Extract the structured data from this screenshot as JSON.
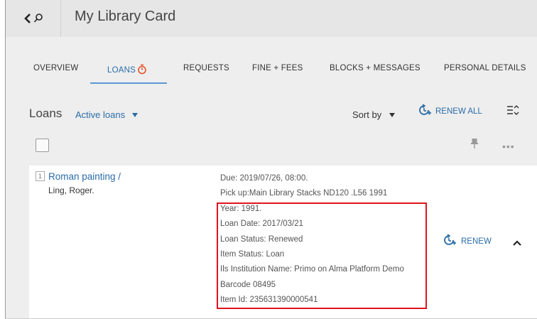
{
  "header": {
    "title": "My Library Card"
  },
  "tabs": [
    {
      "label": "OVERVIEW"
    },
    {
      "label": "LOANS"
    },
    {
      "label": "REQUESTS"
    },
    {
      "label": "FINE + FEES"
    },
    {
      "label": "BLOCKS + MESSAGES"
    },
    {
      "label": "PERSONAL DETAILS"
    }
  ],
  "active_tab": "LOANS",
  "loans": {
    "title": "Loans",
    "filter_value": "Active loans",
    "sort_label": "Sort by",
    "renew_all_label": "RENEW ALL"
  },
  "items": [
    {
      "index": "1",
      "title": "Roman painting /",
      "author": "Ling, Roger.",
      "due": "Due: 2019/07/26, 08:00.",
      "pickup": "Pick up:Main Library Stacks ND120 .L56 1991",
      "year": "Year: 1991.",
      "loan_date": "Loan Date: 2017/03/21",
      "loan_status": "Loan Status: Renewed",
      "item_status": "Item Status: Loan",
      "ils_institution": "Ils Institution Name: Primo on Alma Platform Demo",
      "barcode": "Barcode 08495",
      "item_id": "Item Id: 235631390000541",
      "renew_label": "RENEW"
    }
  ],
  "colors": {
    "accent": "#2a6ca8",
    "timer": "#e8512a",
    "highlight": "#e0141e",
    "background": "#eeeeee"
  }
}
